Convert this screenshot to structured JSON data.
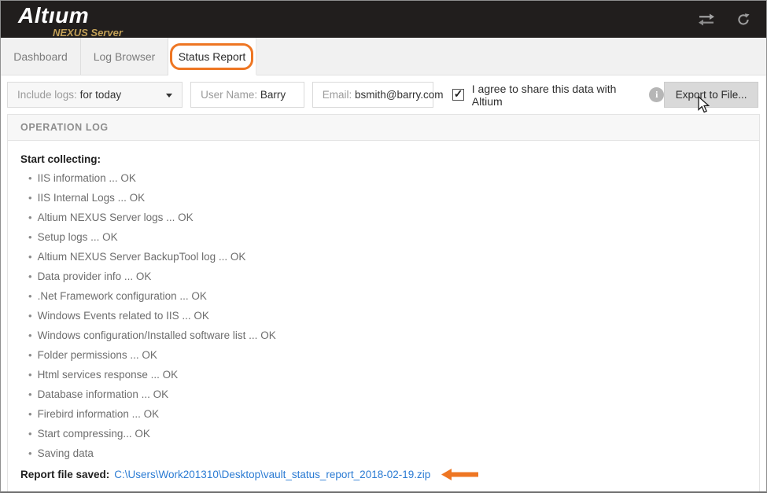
{
  "header": {
    "logo_title": "Altıum",
    "logo_subtitle": "NEXUS Server"
  },
  "tabs": [
    {
      "label": "Dashboard",
      "active": false
    },
    {
      "label": "Log Browser",
      "active": false
    },
    {
      "label": "Status Report",
      "active": true
    }
  ],
  "toolbar": {
    "include_logs_label": "Include logs: ",
    "include_logs_value": "for today",
    "user_name_label": "User Name: ",
    "user_name_value": "Barry",
    "email_label": "Email: ",
    "email_value": "bsmith@barry.com",
    "agree_label": "I agree to share this data with Altium",
    "agree_checked": true,
    "export_button_label": "Export to File..."
  },
  "operation_log": {
    "title": "OPERATION LOG",
    "intro": "Start collecting:",
    "items": [
      "IIS information ... OK",
      "IIS Internal Logs ... OK",
      "Altium NEXUS Server logs ... OK",
      "Setup logs ... OK",
      "Altium NEXUS Server BackupTool log ... OK",
      "Data provider info ... OK",
      ".Net Framework configuration ... OK",
      "Windows Events related to IIS ... OK",
      "Windows configuration/Installed software list ... OK",
      "Folder permissions ... OK",
      "Html services response ... OK",
      "Database information ... OK",
      "Firebird information ... OK",
      "Start compressing... OK",
      "Saving data"
    ],
    "report_label": "Report file saved:",
    "report_link_text": "C:\\Users\\Work201310\\Desktop\\vault_status_report_2018-02-19.zip"
  },
  "colors": {
    "accent_orange": "#ee7623",
    "logo_gold": "#c2a057",
    "link_blue": "#2b7bd3",
    "header_bg": "#211e1d"
  }
}
